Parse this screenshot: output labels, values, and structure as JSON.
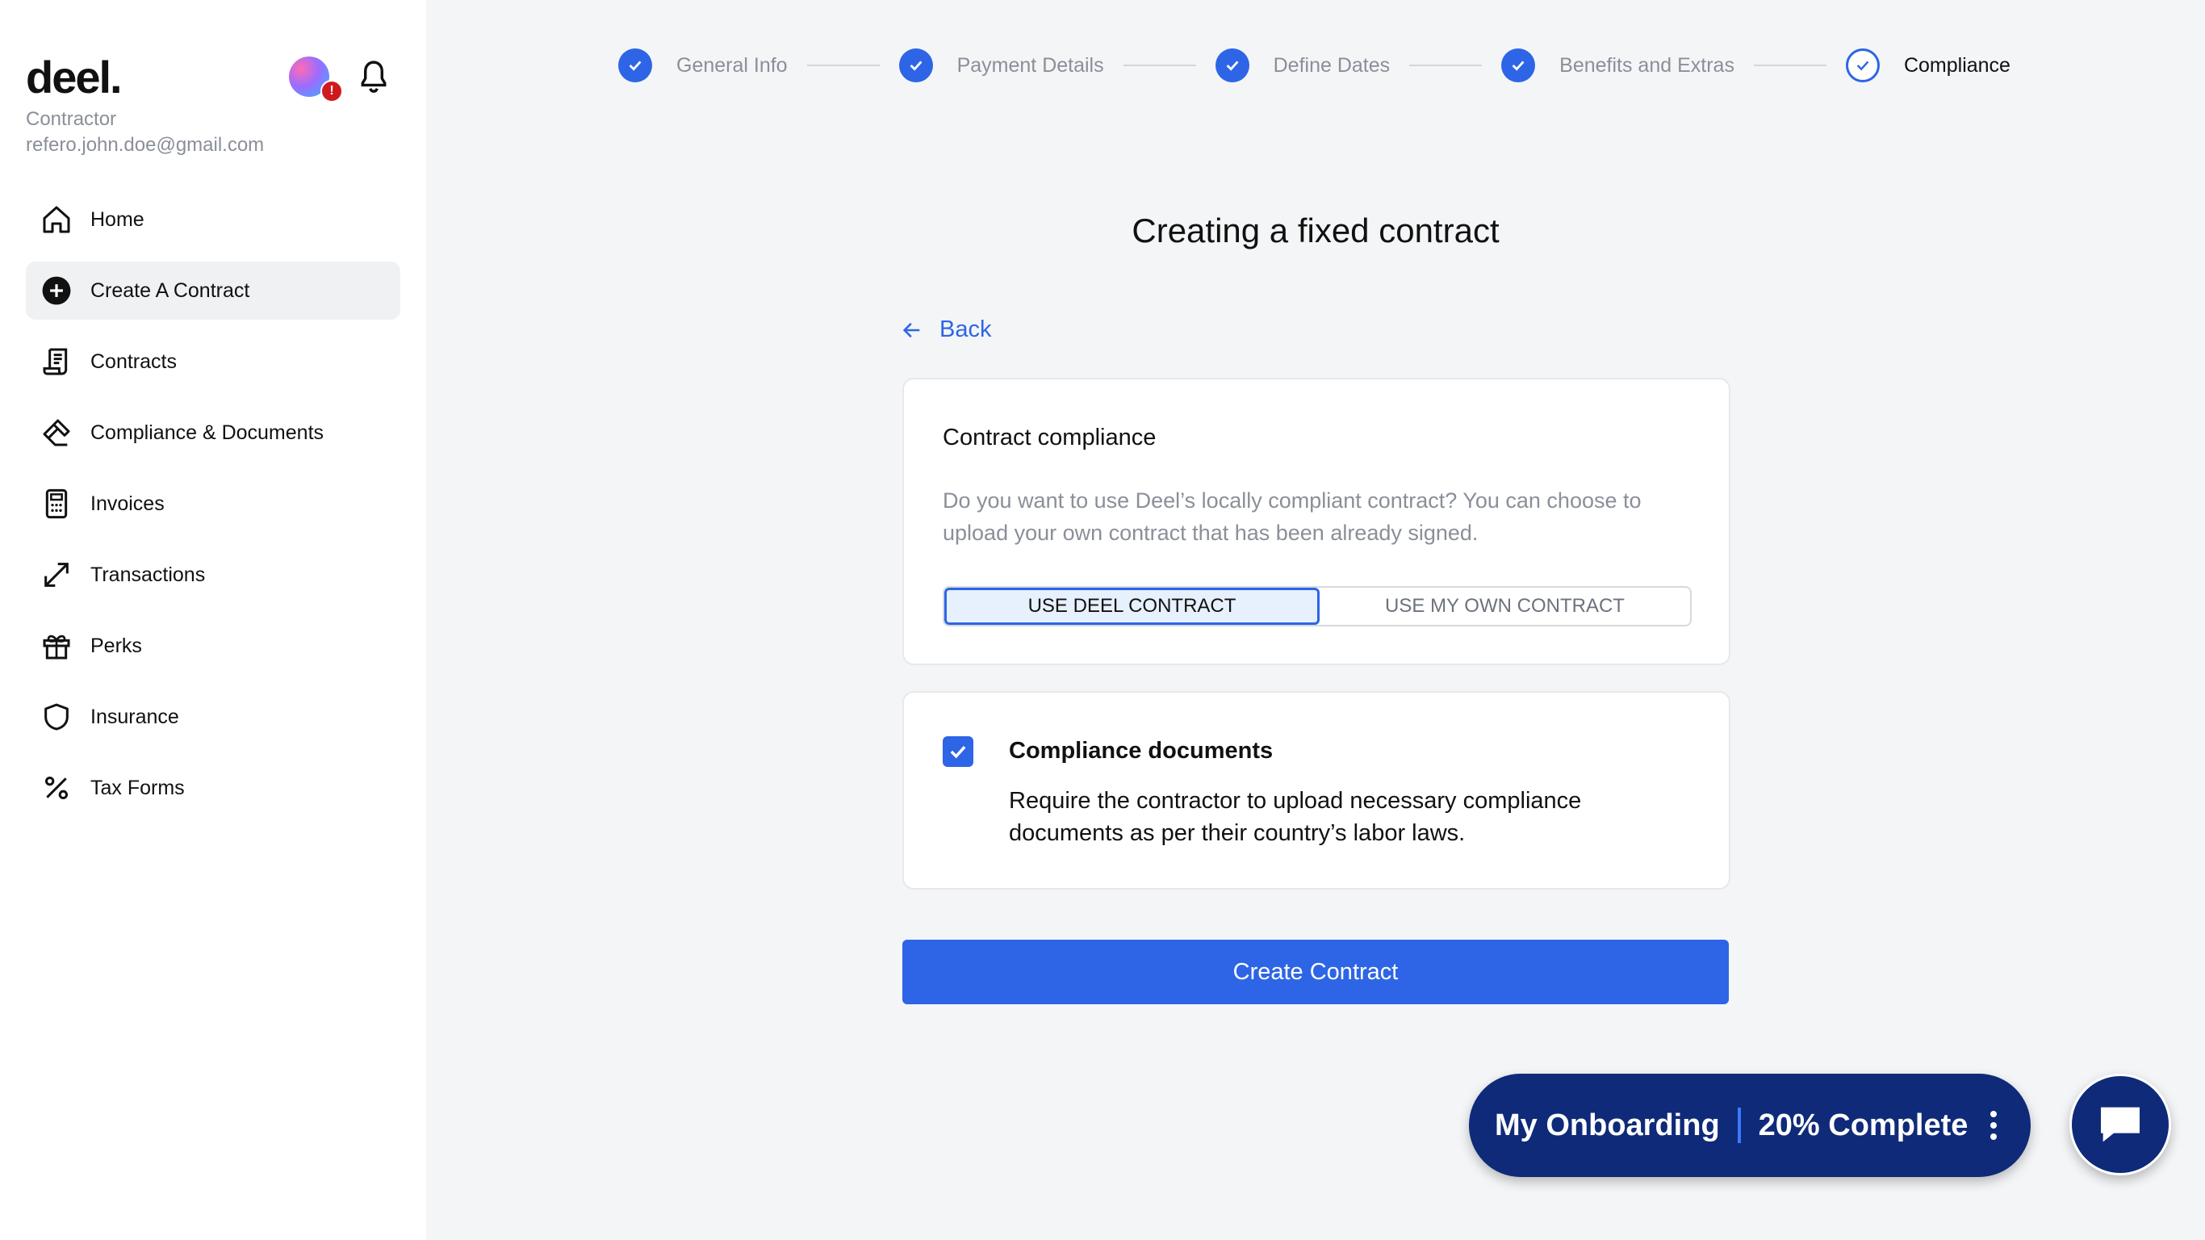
{
  "sidebar": {
    "logo": "deel.",
    "user_role": "Contractor",
    "user_email": "refero.john.doe@gmail.com",
    "avatar_badge": "!",
    "items": [
      {
        "label": "Home",
        "icon": "home-icon"
      },
      {
        "label": "Create A Contract",
        "icon": "plus-circle-icon",
        "active": true
      },
      {
        "label": "Contracts",
        "icon": "contract-scroll-icon"
      },
      {
        "label": "Compliance & Documents",
        "icon": "gavel-icon"
      },
      {
        "label": "Invoices",
        "icon": "calculator-icon"
      },
      {
        "label": "Transactions",
        "icon": "arrows-diagonal-icon"
      },
      {
        "label": "Perks",
        "icon": "gift-icon"
      },
      {
        "label": "Insurance",
        "icon": "shield-icon"
      },
      {
        "label": "Tax Forms",
        "icon": "percent-icon"
      }
    ]
  },
  "stepper": {
    "steps": [
      {
        "label": "General Info",
        "state": "done"
      },
      {
        "label": "Payment Details",
        "state": "done"
      },
      {
        "label": "Define Dates",
        "state": "done"
      },
      {
        "label": "Benefits and Extras",
        "state": "done"
      },
      {
        "label": "Compliance",
        "state": "current"
      }
    ]
  },
  "main": {
    "title": "Creating a fixed contract",
    "back_label": "Back",
    "compliance_card": {
      "heading": "Contract compliance",
      "description": "Do you want to use Deel’s locally compliant contract? You can choose to upload your own contract that has been already signed.",
      "options": [
        "USE DEEL CONTRACT",
        "USE MY OWN CONTRACT"
      ],
      "selected": "USE DEEL CONTRACT"
    },
    "documents_card": {
      "heading": "Compliance documents",
      "description": "Require the contractor to upload necessary compliance documents as per their country’s labor laws.",
      "checked": true
    },
    "create_button": "Create Contract"
  },
  "onboarding": {
    "label": "My Onboarding",
    "progress": "20% Complete"
  },
  "colors": {
    "accent": "#2e65e6",
    "onboarding_bg": "#0f2a78",
    "sidebar_bg": "#ffffff",
    "page_bg": "#f4f5f7"
  }
}
